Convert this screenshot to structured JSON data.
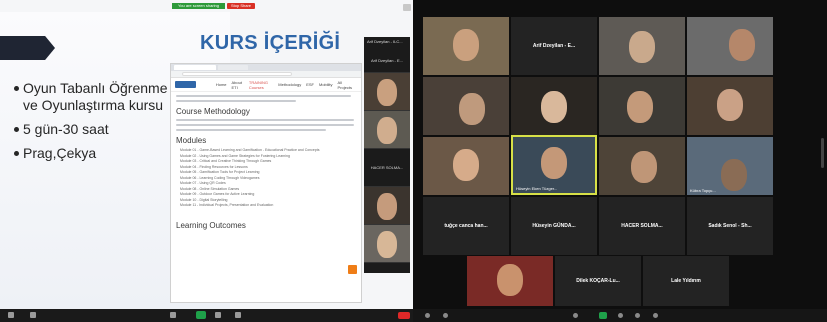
{
  "left_pane": {
    "share_banner": "You are screen sharing",
    "stop_share_label": "Stop Share",
    "slide": {
      "title": "KURS İÇERİĞİ",
      "bullets": [
        "Oyun Tabanlı Öğrenme ve Oyunlaştırma kursu",
        "5 gün-30 saat",
        "Prag,Çekya"
      ]
    },
    "browser": {
      "nav_items": [
        "Home",
        "About ETI",
        "TRAINING Courses",
        "Methodology",
        "ESF",
        "Mobility",
        "All Projects"
      ],
      "methodology_heading": "Course Methodology",
      "modules_heading": "Modules",
      "modules": [
        "Module 01 - Game-Based Learning and Gamification - Educational Practice and Concepts",
        "Module 02 - Using Games and Game Strategies for Fostering Learning",
        "Module 03 - Critical and Creative Thinking Through Games",
        "Module 04 - Finding Resources for Lessons",
        "Module 05 - Gamification Tools for Project Learning",
        "Module 06 - Learning Coding Through Videogames",
        "Module 07 - Using QR Codes",
        "Module 08 - Online Simulation Games",
        "Module 09 - Outdoor Games for Active Learning",
        "Module 10 - Digital Storytelling",
        "Module 11 - Individual Projects, Presentation and Evaluation"
      ],
      "outcomes_heading": "Learning Outcomes"
    },
    "strip": {
      "header": "Arif Dzeyilan - ILC...",
      "first_name": "Arif Dzeyilan - E...",
      "text_tile": "HACER SOLMA..."
    }
  },
  "gallery": {
    "tiles": [
      {
        "label": "",
        "kind": "video",
        "bg": "#7a6a52",
        "face": "#caa07e"
      },
      {
        "label": "Arif Dzeyilan - E...",
        "kind": "text"
      },
      {
        "label": "",
        "kind": "video",
        "bg": "#5e5a55",
        "face": "#c9a98c"
      },
      {
        "label": "",
        "kind": "video",
        "bg": "#6b6b6b",
        "face": "#b5876a"
      },
      {
        "label": "",
        "kind": "video",
        "bg": "#4a4038",
        "face": "#bf9a7d"
      },
      {
        "label": "",
        "kind": "video",
        "bg": "#2a2622",
        "face": "#d9b89b"
      },
      {
        "label": "",
        "kind": "video",
        "bg": "#3d3a35",
        "face": "#c49a7a"
      },
      {
        "label": "",
        "kind": "video",
        "bg": "#4d3f33",
        "face": "#caa186"
      },
      {
        "label": "",
        "kind": "video",
        "bg": "#6b5847",
        "face": "#d6ab8a"
      },
      {
        "label": "Hüseyin Eken Tüzger...",
        "kind": "video",
        "bg": "#3a4a58",
        "face": "#c49878",
        "active": true
      },
      {
        "label": "",
        "kind": "video",
        "bg": "#4e4438",
        "face": "#bf9677"
      },
      {
        "label": "Kübra Topçu...",
        "kind": "video",
        "bg": "#5a6a7a",
        "face": "#8a6c55"
      },
      {
        "label": "tuğçe canca han...",
        "kind": "text"
      },
      {
        "label": "Hüseyin GÜNDA...",
        "kind": "text"
      },
      {
        "label": "HACER SOLMA...",
        "kind": "text"
      },
      {
        "label": "Sadık Senol - Sh...",
        "kind": "text"
      },
      {
        "label": "",
        "kind": "video",
        "bg": "#7a2a26",
        "face": "#c9926d"
      },
      {
        "label": "Dilek KOÇAR-Lu...",
        "kind": "text"
      },
      {
        "label": "Lale Yıldırım",
        "kind": "text"
      }
    ]
  },
  "colors": {
    "active_speaker_border": "#d7e047",
    "slide_title": "#2f66a8",
    "share_banner": "#2e9a3a",
    "stop_share": "#d93025"
  }
}
